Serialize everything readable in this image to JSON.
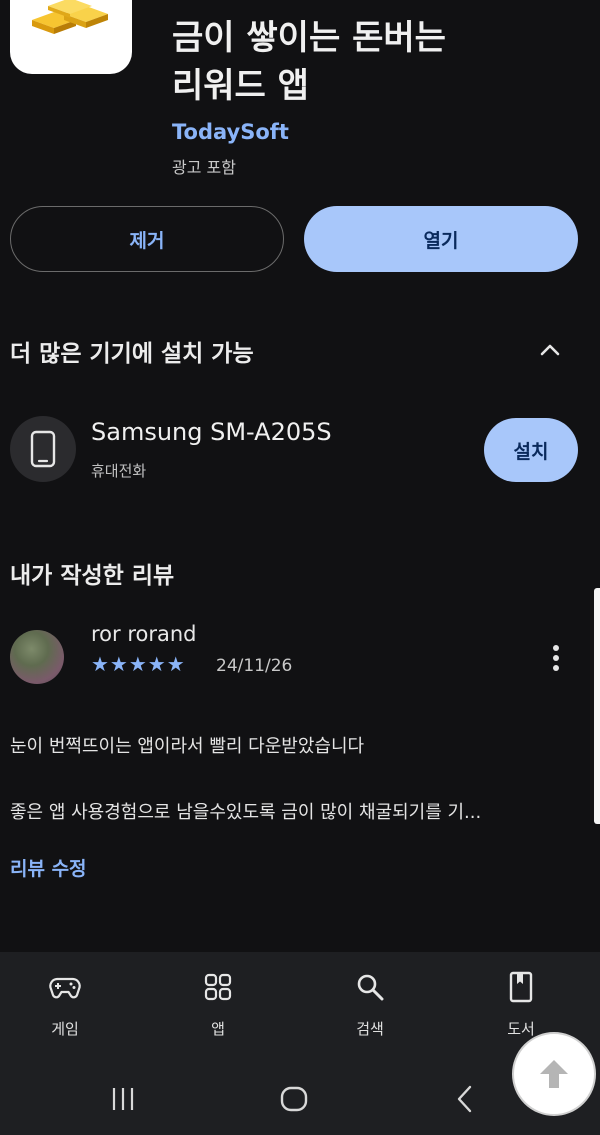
{
  "app": {
    "title_line1": "금이 쌓이는 돈버는",
    "title_line2": "리워드 앱",
    "developer": "TodaySoft",
    "ads_label": "광고 포함",
    "icon": "gold-bars-icon"
  },
  "actions": {
    "uninstall_label": "제거",
    "open_label": "열기"
  },
  "more_devices": {
    "title": "더 많은 기기에 설치 가능",
    "device_name": "Samsung SM-A205S",
    "device_type": "휴대전화",
    "install_label": "설치"
  },
  "review": {
    "section_title": "내가 작성한 리뷰",
    "reviewer": "ror rorand",
    "stars_text": "★★★★★",
    "rating": 5,
    "date": "24/11/26",
    "line1": "눈이 번쩍뜨이는 앱이라서 빨리 다운받았습니다",
    "line2": "좋은 앱 사용경험으로 남을수있도록 금이 많이 채굴되기를 기...",
    "edit_label": "리뷰 수정"
  },
  "bottom_nav": {
    "games": "게임",
    "apps": "앱",
    "search": "검색",
    "books": "도서"
  },
  "colors": {
    "background": "#111113",
    "accent": "#8ab4f8",
    "button_fill": "#a8c7fa"
  }
}
